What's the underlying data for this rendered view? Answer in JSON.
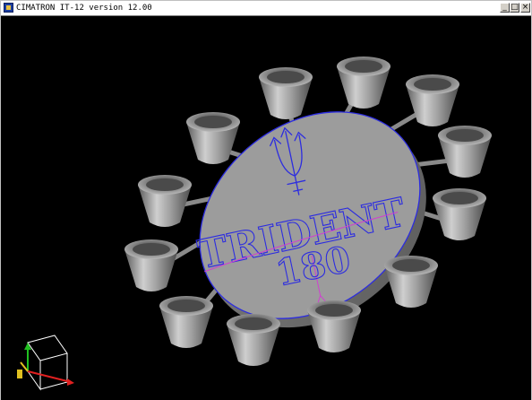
{
  "window": {
    "title": "CIMATRON IT-12 version 12.00",
    "minimize_label": "_",
    "maximize_label": "□",
    "close_label": "×"
  },
  "model": {
    "line1": "TRIDENT",
    "line2": "180",
    "colors": {
      "background": "#000000",
      "body": "#9a9a9a",
      "outline": "#2c2ce0",
      "highlight": "#d040d0"
    }
  },
  "axis_triad": {
    "x_color": "#e02020",
    "y_color": "#20c020",
    "z_color": "#e0c020"
  }
}
